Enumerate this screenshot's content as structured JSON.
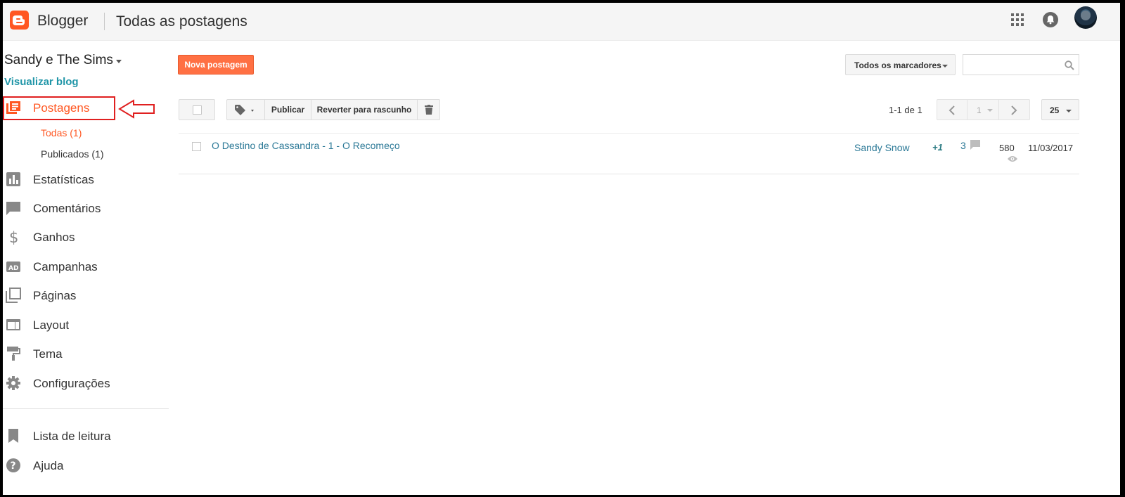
{
  "header": {
    "brand": "Blogger",
    "page_title": "Todas as postagens",
    "icons": [
      "apps-grid-icon",
      "notifications-bell-icon"
    ]
  },
  "sidebar": {
    "blog_name": "Sandy e The Sims",
    "view_blog": "Visualizar blog",
    "items": [
      {
        "label": "Postagens",
        "icon": "posts-icon",
        "active": true
      },
      {
        "label": "Estatísticas",
        "icon": "stats-icon"
      },
      {
        "label": "Comentários",
        "icon": "comments-icon"
      },
      {
        "label": "Ganhos",
        "icon": "dollar-icon"
      },
      {
        "label": "Campanhas",
        "icon": "ad-icon"
      },
      {
        "label": "Páginas",
        "icon": "pages-icon"
      },
      {
        "label": "Layout",
        "icon": "layout-icon"
      },
      {
        "label": "Tema",
        "icon": "paint-roller-icon"
      },
      {
        "label": "Configurações",
        "icon": "gear-icon"
      }
    ],
    "sub_items": [
      {
        "label": "Todas (1)",
        "active": true
      },
      {
        "label": "Publicados (1)"
      }
    ],
    "bottom_items": [
      {
        "label": "Lista de leitura",
        "icon": "bookmark-icon"
      },
      {
        "label": "Ajuda",
        "icon": "help-icon"
      }
    ]
  },
  "toolbar": {
    "new_post": "Nova postagem",
    "labels_filter": "Todos os marcadores",
    "search_placeholder": "",
    "publish": "Publicar",
    "revert": "Reverter para rascunho",
    "pager_text": "1-1 de 1",
    "page_number": "1",
    "per_page": "25"
  },
  "posts": [
    {
      "title": "O Destino de Cassandra - 1 - O Recomeço",
      "author": "Sandy Snow",
      "plus": "+1",
      "comments": "3",
      "views": "580",
      "date": "11/03/2017"
    }
  ],
  "colors": {
    "accent": "#ff5722",
    "link": "#2a7896",
    "annotation": "#e02020"
  }
}
